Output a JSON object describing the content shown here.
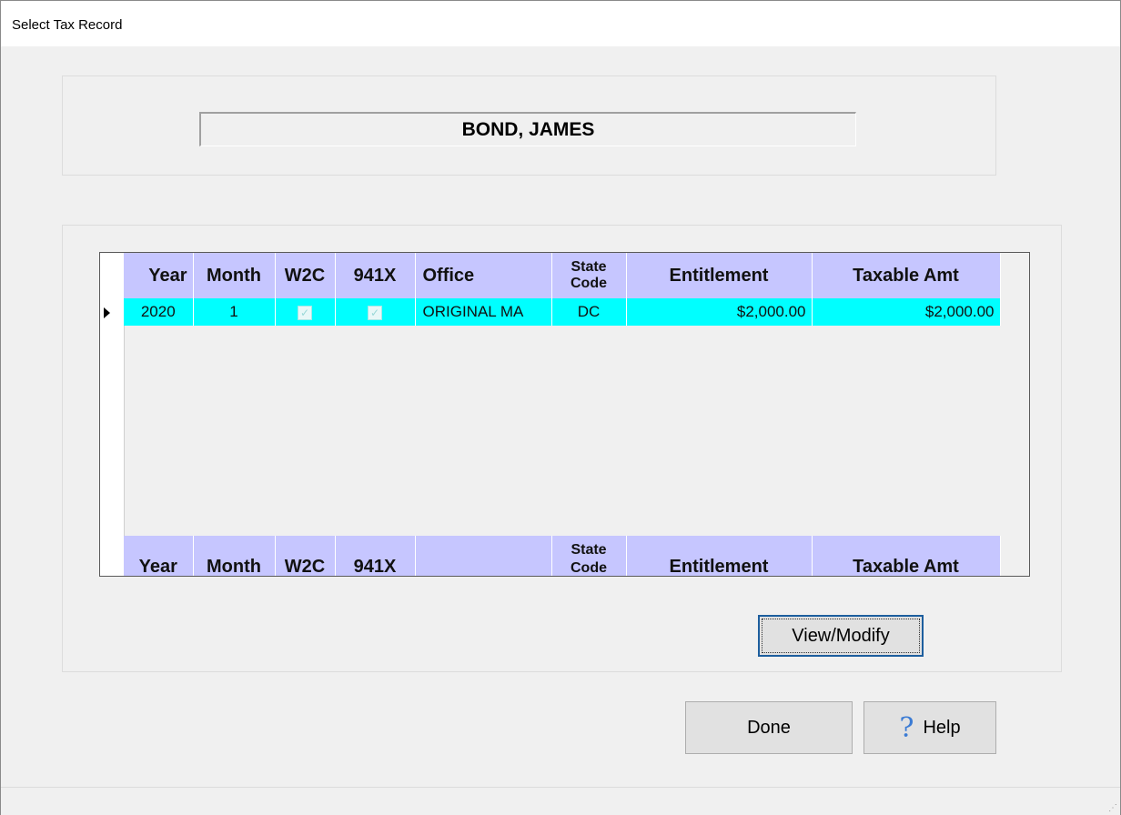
{
  "window": {
    "title": "Select Tax Record"
  },
  "employee": {
    "name": "BOND, JAMES"
  },
  "grid": {
    "headers": {
      "year": "Year",
      "month": "Month",
      "w2c": "W2C",
      "f941x": "941X",
      "office": "Office",
      "state_code_1": "State",
      "state_code_2": "Code",
      "entitlement": "Entitlement",
      "taxable_amt": "Taxable Amt"
    },
    "rows": [
      {
        "year": "2020",
        "month": "1",
        "w2c": true,
        "f941x": true,
        "office": "ORIGINAL MA",
        "state_code": "DC",
        "entitlement": "$2,000.00",
        "taxable_amt": "$2,000.00"
      }
    ],
    "footer": {
      "year": "Year",
      "month": "Month",
      "w2c": "W2C",
      "f941x": "941X",
      "office": "",
      "state_code_1": "State",
      "state_code_2": "Code",
      "entitlement": "Entitlement",
      "taxable_amt": "Taxable Amt"
    }
  },
  "buttons": {
    "view_modify": "View/Modify",
    "done": "Done",
    "help": "Help"
  },
  "colors": {
    "header_bg": "#c6c6ff",
    "selected_row_bg": "#00ffff"
  },
  "icons": {
    "help": "question-mark-icon",
    "row_pointer": "row-pointer-icon"
  }
}
